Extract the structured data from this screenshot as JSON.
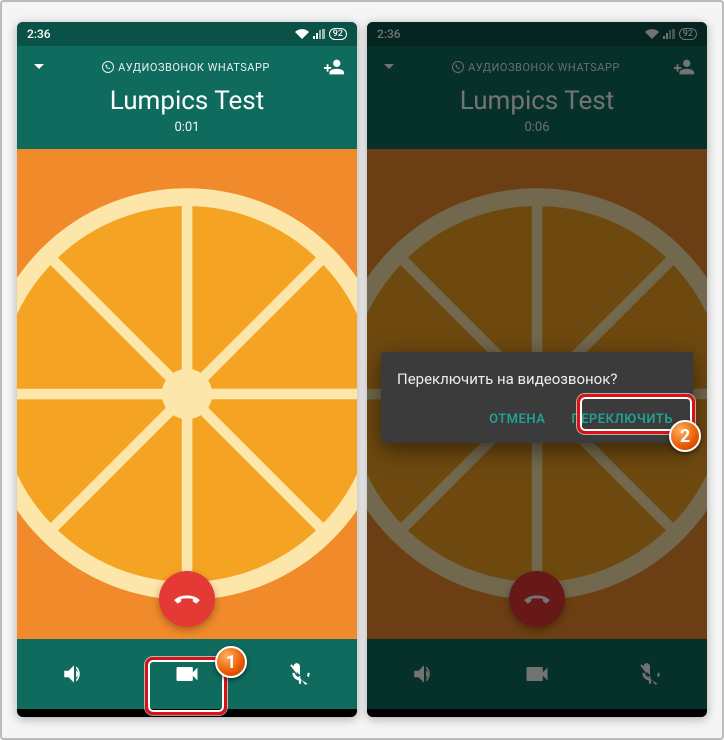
{
  "screen1": {
    "statusbar": {
      "time": "2:36",
      "battery": "92"
    },
    "header": {
      "call_type": "АУДИОЗВОНОК WHATSAPP",
      "contact": "Lumpics Test",
      "duration": "0:01"
    },
    "marker": "1"
  },
  "screen2": {
    "statusbar": {
      "time": "2:36",
      "battery": "92"
    },
    "header": {
      "call_type": "АУДИОЗВОНОК WHATSAPP",
      "contact": "Lumpics Test",
      "duration": "0:06"
    },
    "dialog": {
      "message": "Переключить на видеозвонок?",
      "cancel": "ОТМЕНА",
      "confirm": "ПЕРЕКЛЮЧИТЬ"
    },
    "marker": "2"
  }
}
